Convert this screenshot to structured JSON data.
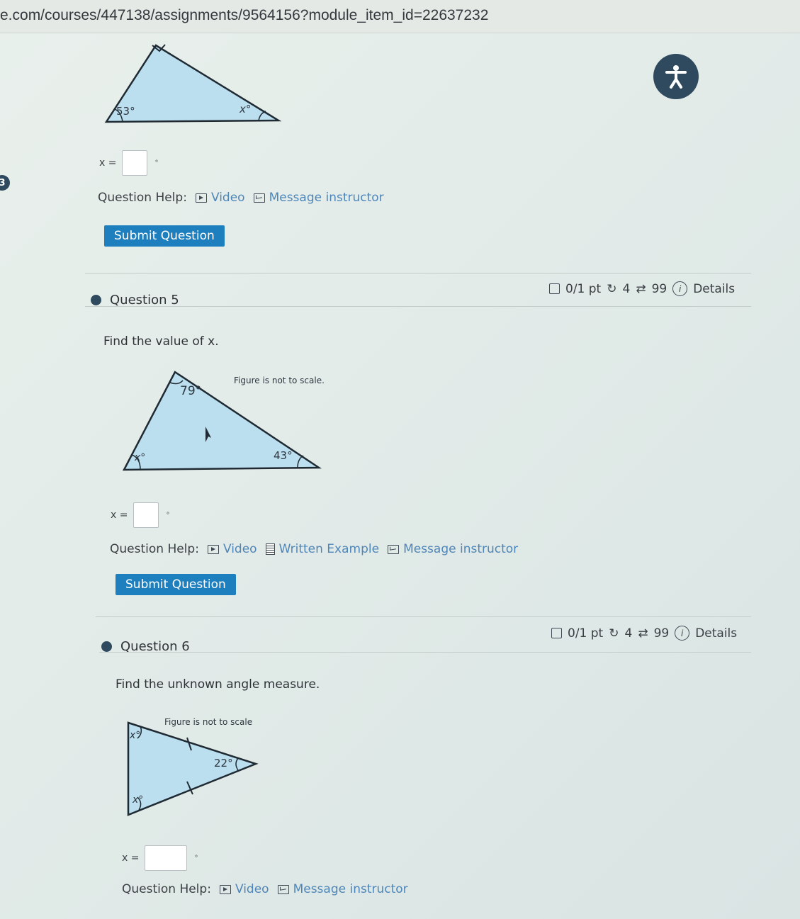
{
  "browser": {
    "url": "e.com/courses/447138/assignments/9564156?module_item_id=22637232"
  },
  "badge_number": "3",
  "q4": {
    "angles": {
      "left": "53°",
      "right": "x°"
    },
    "equation_label": "x =",
    "degree": "°",
    "help_label": "Question Help:",
    "video_label": "Video",
    "message_label": "Message instructor",
    "submit_label": "Submit Question"
  },
  "q5": {
    "title": "Question 5",
    "score": "0/1 pt",
    "retries": "4",
    "attempts": "99",
    "details": "Details",
    "prompt": "Find the value of x.",
    "figure_note": "Figure is not to scale.",
    "angles": {
      "top": "79°",
      "left": "x°",
      "right": "43°"
    },
    "equation_label": "x =",
    "degree": "°",
    "help_label": "Question Help:",
    "video_label": "Video",
    "example_label": "Written Example",
    "message_label": "Message instructor",
    "submit_label": "Submit Question"
  },
  "q6": {
    "title": "Question 6",
    "score": "0/1 pt",
    "retries": "4",
    "attempts": "99",
    "details": "Details",
    "prompt": "Find the unknown angle measure.",
    "figure_note": "Figure is not to scale",
    "angles": {
      "top": "x°",
      "right": "22°",
      "bottom": "x°"
    },
    "equation_label": "x =",
    "degree": "°",
    "help_label": "Question Help:",
    "video_label": "Video",
    "message_label": "Message instructor"
  },
  "colors": {
    "button": "#1e7fbf",
    "link": "#4f86b8",
    "triangle_fill": "#bcdff0",
    "triangle_stroke": "#1f2a33"
  }
}
